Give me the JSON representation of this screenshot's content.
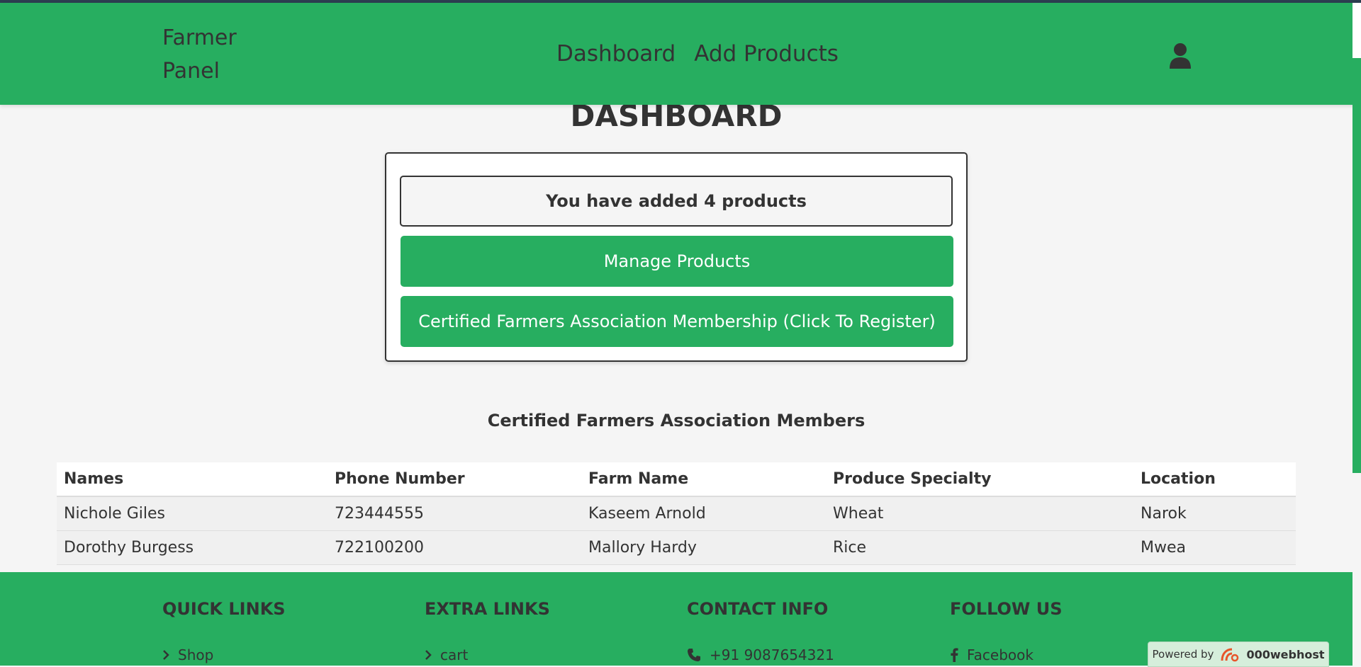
{
  "header": {
    "brand": "Farmer\nPanel",
    "nav": [
      "Dashboard",
      "Add Products"
    ],
    "user_icon": "user-icon"
  },
  "main": {
    "title": "DASHBOARD",
    "product_count_text": "You have added 4 products",
    "manage_button": "Manage Products",
    "register_button": "Certified Farmers Association Membership (Click To Register)",
    "members_title": "Certified Farmers Association Members"
  },
  "table": {
    "headers": [
      "Names",
      "Phone Number",
      "Farm Name",
      "Produce Specialty",
      "Location"
    ],
    "rows": [
      [
        "Nichole Giles",
        "723444555",
        "Kaseem Arnold",
        "Wheat",
        "Narok"
      ],
      [
        "Dorothy Burgess",
        "722100200",
        "Mallory Hardy",
        "Rice",
        "Mwea"
      ]
    ]
  },
  "footer": {
    "quick_links": {
      "title": "QUICK LINKS",
      "first": "Shop"
    },
    "extra_links": {
      "title": "EXTRA LINKS",
      "first": "cart"
    },
    "contact_info": {
      "title": "CONTACT INFO",
      "first": "+91 9087654321"
    },
    "follow_us": {
      "title": "FOLLOW US",
      "first": "Facebook"
    }
  },
  "badge": {
    "powered_by": "Powered by",
    "brand": "000webhost"
  },
  "colors": {
    "primary": "#27ae60",
    "text": "#333333",
    "background": "#f5f5f5"
  }
}
